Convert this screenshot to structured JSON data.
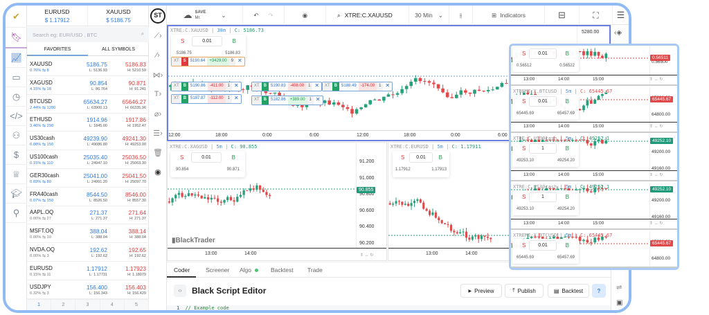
{
  "colors": {
    "accent": "#2c7be5",
    "up": "#26a17b",
    "down": "#e04a4a",
    "frame": "#8fbaf3"
  },
  "header_tickers": [
    {
      "symbol": "EURUSD",
      "price": "$ 1.17912"
    },
    {
      "symbol": "XAUUSD",
      "price": "$ 5186.75"
    }
  ],
  "search": {
    "placeholder": "Search eg: EUR/USD , BTC"
  },
  "watch_tabs": [
    "FAVORITES",
    "ALL SYMBOLS"
  ],
  "watchlist": [
    {
      "symbol": "XAUUSD",
      "change": "0.76% ⇆ 8",
      "bid": "5186.75",
      "ask": "5186.83",
      "low": "L: 5136.93",
      "high": "H: 5210.59"
    },
    {
      "symbol": "XAGUSD",
      "change": "4.15% ⇆ 18",
      "bid": "90.854",
      "ask": "90.871",
      "low": "L: 86.764",
      "high": "H: 91.241"
    },
    {
      "symbol": "BTCUSD",
      "change": "2.44% ⇆ 1200",
      "bid": "65634.27",
      "ask": "65646.27",
      "low": "L: 63900.13",
      "high": "H: 66335.96"
    },
    {
      "symbol": "ETHUSD",
      "change": "3.46% ⇆ 290",
      "bid": "1914.96",
      "ask": "1917.86",
      "low": "L: 1845.00",
      "high": "H: 1952.47"
    },
    {
      "symbol": "US30cash",
      "change": "0.08% ⇆ 150",
      "bid": "49239.90",
      "ask": "49241.30",
      "low": "L: 49086.80",
      "high": "H: 49253.00"
    },
    {
      "symbol": "US100cash",
      "change": "0.15% ⇆ 110",
      "bid": "25035.40",
      "ask": "25036.50",
      "low": "L: 24947.10",
      "high": "H: 25063.30"
    },
    {
      "symbol": "GER30cash",
      "change": "0.03% ⇆ 80",
      "bid": "25041.00",
      "ask": "25041.50",
      "low": "L: 24991.20",
      "high": "H: 25097.70"
    },
    {
      "symbol": "FRA40cash",
      "change": "0.07% ⇆ 150",
      "bid": "8544.50",
      "ask": "8546.00",
      "low": "L: 8526.50",
      "high": "H: 8557.30"
    },
    {
      "symbol": "AAPL.OQ",
      "change": "0.00% ⇆ 27",
      "bid": "271.37",
      "ask": "271.64",
      "low": "L: 271.37",
      "high": "H: 271.37"
    },
    {
      "symbol": "MSFT.OQ",
      "change": "0.00% ⇆ 10",
      "bid": "388.04",
      "ask": "388.14",
      "low": "L: 388.04",
      "high": "H: 388.04"
    },
    {
      "symbol": "NVDA.OQ",
      "change": "0.00% ⇆ 3",
      "bid": "192.62",
      "ask": "192.65",
      "low": "L: 192.62",
      "high": "H: 192.62"
    },
    {
      "symbol": "EURUSD",
      "change": "0.15% ⇆ 11",
      "bid": "1.17912",
      "ask": "1.17923",
      "low": "L: 1.17731",
      "high": "H: 1.18079"
    },
    {
      "symbol": "USDJPY",
      "change": "0.32% ⇆ 3",
      "bid": "156.400",
      "ask": "156.403",
      "low": "L: 156.343",
      "high": "H: 156.429"
    }
  ],
  "pages": [
    "1",
    "2",
    "3",
    "4",
    "5"
  ],
  "toolbar": {
    "save": "SAVE",
    "save_sub": "Mr.",
    "symbol": "XTRE:C.XAUUSD",
    "timeframe": "30 Min",
    "indicators": "Indicators"
  },
  "main_chart": {
    "symbol": "XTRE:C.XAUUSD",
    "tf": "38m",
    "close": "C: 5186.73",
    "qty": "0.01",
    "bid": "5186.75",
    "ask": "5186.83",
    "axis": [
      "5280.00"
    ],
    "times": [
      "12:00",
      "18:00",
      "0:00",
      "6:00",
      "12:00",
      "18:00",
      "0:00",
      "6:00",
      "12:00"
    ],
    "positions": [
      {
        "side": "S",
        "price": "5190.64",
        "pnl": "+3429.00",
        "qty": "9"
      },
      {
        "side": "B",
        "price": "5190.86",
        "pnl": "-411.00",
        "qty": "1"
      },
      {
        "side": "B",
        "price": "5187.87",
        "pnl": "-112.00",
        "qty": "1"
      },
      {
        "side": "B",
        "price": "5190.83",
        "pnl": "-408.00",
        "qty": "1"
      },
      {
        "side": "B",
        "price": "5182.86",
        "pnl": "+389.00",
        "qty": "1"
      },
      {
        "side": "B",
        "price": "5188.49",
        "pnl": "-174.00",
        "qty": "1"
      }
    ]
  },
  "xag_chart": {
    "symbol": "XTRE:C.XAGUSD",
    "tf": "5m",
    "close": "C: 90.855",
    "qty": "0.01",
    "bid": "90.854",
    "ask": "90.871",
    "axis": [
      "91.200",
      "91.000",
      "90.800",
      "90.600",
      "90.400",
      "90.200"
    ],
    "last": "90.855",
    "times": [
      "13:00",
      "14:00"
    ],
    "watermark": "BlackTrader"
  },
  "eur_chart": {
    "symbol": "XTRE:C.EURUSD",
    "tf": "5m",
    "close": "C: 1.17911",
    "qty": "0.01",
    "bid": "1.17912",
    "ask": "1.17913",
    "times": [
      "13:00",
      "14:00"
    ]
  },
  "popup": [
    {
      "symbol": "",
      "tf": "",
      "close": "",
      "qty": "0.01",
      "bid": "0.56512",
      "ask": "0.56522",
      "last": "0.56511",
      "axis": [
        "0.56500"
      ],
      "times": [
        "13:00",
        "14:00",
        "15:00"
      ],
      "dir": "down"
    },
    {
      "symbol": "XTREME:X.BTCUSD",
      "tf": "5m",
      "close": "C: 65445.67",
      "qty": "0.01",
      "bid": "65445.69",
      "ask": "65457.69",
      "last": "65445.67",
      "axis": [
        "65600.00",
        "64800.00"
      ],
      "times": [
        "13:00",
        "14:00",
        "15:00"
      ],
      "dir": "down"
    },
    {
      "symbol": "XTRE:C.US30cash",
      "tf": "5m",
      "close": "C: 49252.1",
      "qty": "1",
      "bid": "49253.10",
      "ask": "49254.20",
      "last": "49252.10",
      "axis": [
        "49200.00",
        "49160.00"
      ],
      "times": [
        "13:00",
        "14:00",
        "15:00"
      ],
      "dir": "up"
    },
    {
      "symbol": "XTRE:C.US30cash",
      "tf": "5m",
      "close": "C: 49252.1",
      "qty": "1",
      "bid": "49253.10",
      "ask": "49254.20",
      "last": "49252.10",
      "axis": [
        "49200.00",
        "49160.00"
      ],
      "times": [
        "13:00",
        "14:00",
        "15:00"
      ],
      "dir": "up"
    },
    {
      "symbol": "XTREME:X.BTCUSD",
      "tf": "5m",
      "close": "C: 65445.67",
      "qty": "0.01",
      "bid": "65445.69",
      "ask": "65457.69",
      "last": "65445.67",
      "axis": [
        "65600.00",
        "64800.00"
      ],
      "times": [],
      "dir": "down"
    }
  ],
  "bottom_tabs": [
    "Coder",
    "Screener",
    "Algo",
    "Backtest",
    "Trade"
  ],
  "editor": {
    "title": "Black Script Editor",
    "preview": "Preview",
    "publish": "Publish",
    "backtest": "Backtest",
    "help": "?",
    "line_no": "1",
    "code": "// Example code"
  }
}
